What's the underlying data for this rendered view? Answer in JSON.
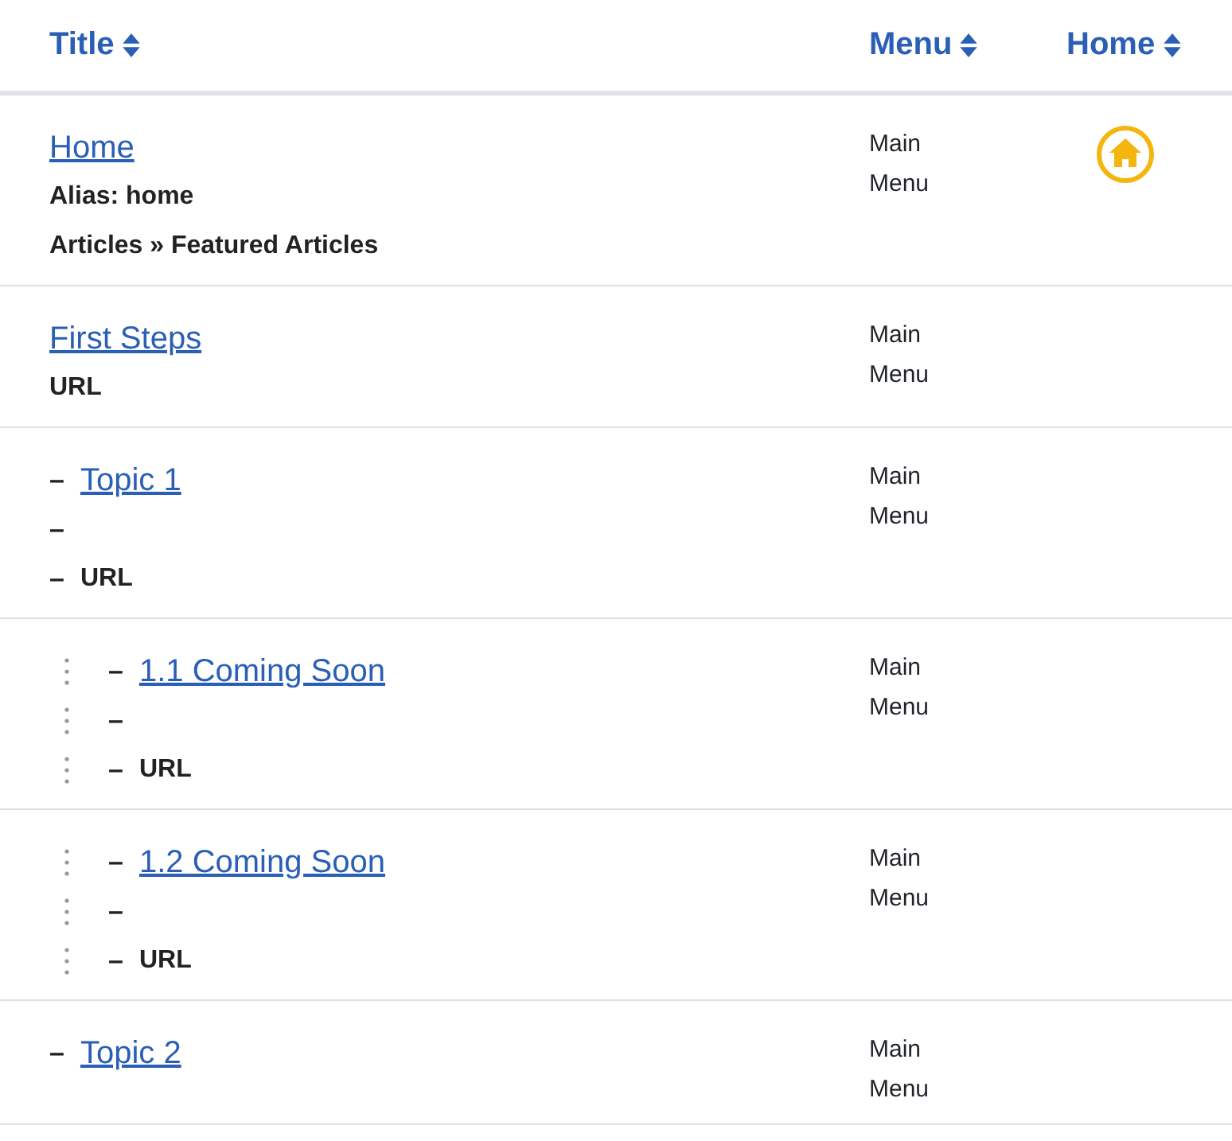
{
  "columns": [
    {
      "label": "Title"
    },
    {
      "label": "Menu"
    },
    {
      "label": "Home"
    }
  ],
  "rows": [
    {
      "title": {
        "text": "Home"
      },
      "lines": [
        {
          "text": "Alias: home"
        },
        {
          "text": "Articles » Featured Articles"
        }
      ],
      "menu": [
        "Main",
        "Menu"
      ],
      "home": true
    },
    {
      "title": {
        "text": "First Steps"
      },
      "lines": [
        {
          "text": "URL"
        }
      ],
      "menu": [
        "Main",
        "Menu"
      ],
      "home": false
    },
    {
      "title": {
        "dash": "–",
        "text": "Topic 1"
      },
      "lines": [
        {
          "dash": "–"
        },
        {
          "dash": "–",
          "text": "URL"
        }
      ],
      "menu": [
        "Main",
        "Menu"
      ],
      "home": false,
      "children": [
        {
          "title": {
            "dash": "–",
            "text": "1.1 Coming Soon"
          },
          "lines": [
            {
              "dash": "–"
            },
            {
              "dash": "–",
              "text": "URL"
            }
          ],
          "menu": [
            "Main",
            "Menu"
          ],
          "home": false
        },
        {
          "title": {
            "dash": "–",
            "text": "1.2 Coming Soon"
          },
          "lines": [
            {
              "dash": "–"
            },
            {
              "dash": "–",
              "text": "URL"
            }
          ],
          "menu": [
            "Main",
            "Menu"
          ],
          "home": false
        }
      ]
    },
    {
      "title": {
        "dash": "–",
        "text": "Topic 2"
      },
      "menu": [
        "Main",
        "Menu"
      ],
      "home": false
    }
  ]
}
